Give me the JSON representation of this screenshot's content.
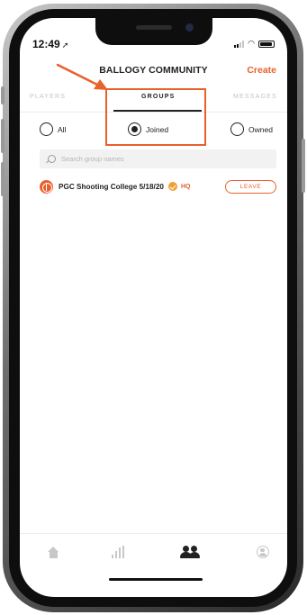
{
  "status_bar": {
    "time": "12:49",
    "location_icon": "location-arrow-icon",
    "signal_icon": "cellular-signal-icon",
    "wifi_icon": "wifi-icon",
    "battery_icon": "battery-icon"
  },
  "header": {
    "title": "BALLOGY COMMUNITY",
    "create_label": "Create"
  },
  "tabs": [
    {
      "label": "PLAYERS",
      "active": false
    },
    {
      "label": "GROUPS",
      "active": true
    },
    {
      "label": "MESSAGES",
      "active": false
    }
  ],
  "filters": [
    {
      "label": "All",
      "selected": false
    },
    {
      "label": "Joined",
      "selected": true
    },
    {
      "label": "Owned",
      "selected": false
    }
  ],
  "search": {
    "placeholder": "Search group names",
    "value": ""
  },
  "groups": [
    {
      "name": "PGC Shooting College 5/18/20",
      "verified": true,
      "badge": "HQ",
      "action_label": "LEAVE"
    }
  ],
  "bottom_nav": [
    {
      "icon": "home-icon",
      "active": false
    },
    {
      "icon": "stats-icon",
      "active": false
    },
    {
      "icon": "community-icon",
      "active": true
    },
    {
      "icon": "profile-icon",
      "active": false
    }
  ],
  "colors": {
    "accent": "#e8602c",
    "text": "#222222",
    "inactive": "#c4c4c4",
    "verified": "#f0a033"
  }
}
